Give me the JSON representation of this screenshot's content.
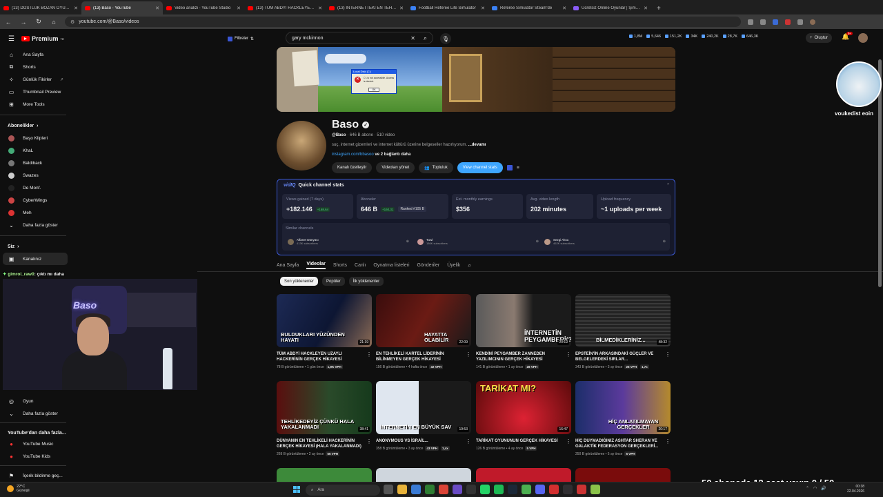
{
  "browser": {
    "tabs": [
      {
        "label": "(13) DOSTLUK BOZAN OYUN...",
        "icon": "youtube-icon"
      },
      {
        "label": "(13) Baso - YouTube",
        "icon": "youtube-icon",
        "active": true
      },
      {
        "label": "Video analizi - YouTube Studio",
        "icon": "youtube-icon"
      },
      {
        "label": "(13) TÜM ABDYİ HACKLEYEN U...",
        "icon": "youtube-icon"
      },
      {
        "label": "(13) İNTERNETTEKİ EN TEHLİKE...",
        "icon": "youtube-icon"
      },
      {
        "label": "Football Referee Life Simulator",
        "icon": "steam-icon"
      },
      {
        "label": "Referee Simulator Steam'de",
        "icon": "steam-icon"
      },
      {
        "label": "Ücretsiz Online Oyunlar | Şimdi...",
        "icon": "game-icon"
      }
    ],
    "new_tab": "+",
    "url": "youtube.com/@Baso/videos"
  },
  "yt": {
    "brand": "Premium",
    "brand_sup": "TR",
    "filters_label": "Filtreler",
    "search_value": "gary mckinnon",
    "create_label": "Oluştur",
    "notif_count": "9+",
    "header_stats": [
      "1,8M",
      "5,646",
      "151,2K",
      "34K",
      "240,2K",
      "28,7K",
      "646,3K"
    ]
  },
  "sidebar": {
    "main": [
      "Ana Sayfa",
      "Shorts",
      "Günlük Fikirler",
      "Thumbnail Preview",
      "More Tools"
    ],
    "subs_title": "Abonelikler",
    "subs": [
      "Başo Klipleri",
      "KhaL",
      "Baldiback",
      "Swazes",
      "De Monf.",
      "CyberWings",
      "Meh"
    ],
    "subs_more": "Daha fazla göster",
    "you_title": "Siz",
    "you_items": [
      "Kanalınız"
    ],
    "explore": [
      "Oyun"
    ],
    "explore_more": "Daha fazla göster",
    "more_title": "YouTube'dan daha fazla...",
    "more_items": [
      "YouTube Music",
      "YouTube Kids"
    ],
    "bottom": "İçerik bildirme geç..."
  },
  "chat": {
    "user": "gimroi_raw0",
    "msg": ": çıktı mı daha"
  },
  "cam": {
    "neon": "Baso"
  },
  "dialog": {
    "title": "Local Disk (C:)",
    "msg": "C:\\ is not accessible. Access is denied.",
    "ok": "OK"
  },
  "channel": {
    "name": "Baso",
    "handle": "@Baso",
    "subs": "646 B abone",
    "videos": "510 video",
    "desc": "suç, internet gizemleri ve internet kültürü üzerine belgeseller hazırlıyorum.",
    "desc_more": "...devamı",
    "link": "instagram.com/bbasoo",
    "link_more": "ve 2 bağlantı daha",
    "buttons": [
      "Kanalı özelleştir",
      "Videoları yönet",
      "Topluluk",
      "View channel stats"
    ]
  },
  "vidiq": {
    "title_brand": "vidIQ",
    "title": "Quick channel stats",
    "cards": [
      {
        "label": "Views gained (7 days)",
        "value": "+182.146",
        "delta": "+168,64"
      },
      {
        "label": "Aboneler",
        "value": "646 B",
        "delta": "+160,31",
        "rank": "Ranked #105 B"
      },
      {
        "label": "Est. monthly earnings",
        "value": "$356"
      },
      {
        "label": "Avg. video length",
        "value": "202 minutes"
      },
      {
        "label": "Upload frequency",
        "value": "~1 uploads per week"
      }
    ],
    "similar_label": "Similar channels",
    "similar": [
      {
        "name": "Alfanet Dünyası",
        "subs": "413K subscribers"
      },
      {
        "name": "Tuwi",
        "subs": "186K subscribers"
      },
      {
        "name": "Sezgi Aksu",
        "subs": "462K subscribers"
      }
    ]
  },
  "tabs": [
    "Ana Sayfa",
    "Videolar",
    "Shorts",
    "Canlı",
    "Oynatma listeleri",
    "Gönderiler",
    "Üyelik"
  ],
  "chips": [
    "Son yüklenenler",
    "Popüler",
    "İlk yüklenenler"
  ],
  "videos": [
    {
      "thumb": "BULDUKLARI YÜZÜNDEN HAYATI",
      "dur": "21:19",
      "title": "TÜM ABDYİ HACKLEYEN UZAYLI HACKERİNİN GERÇEK HİKAYESİ",
      "meta": "78 B görüntüleme • 1 gün önce",
      "vph": "1,9K VPH",
      "x": ""
    },
    {
      "thumb": "HAYATTA OLABİLİR",
      "dur": "22:09",
      "title": "EN TEHLİKELİ KARTEL LİDERİNİN BİLİNMEYEN GERÇEK HİKAYESİ",
      "meta": "156 B görüntüleme • 4 hafta önce",
      "vph": "32 VPH",
      "x": ""
    },
    {
      "thumb": "İNTERNETİN PEYGAMBERİ(?)",
      "dur": "20:12",
      "title": "KENDİNİ PEYGAMBER ZANNEDEN YAZILIMCININ GERÇEK HİKAYESİ",
      "meta": "141 B görüntüleme • 1 ay önce",
      "vph": "28 VPH",
      "x": ""
    },
    {
      "thumb": "BİLMEDİKLERİNİZ...",
      "dur": "48:32",
      "title": "EPSTEİN'İN ARKASINDAKİ GÜÇLER VE BELGELERDEKİ SIRLAR...",
      "meta": "343 B görüntüleme • 3 ay önce",
      "vph": "26 VPH",
      "x": "1,7x"
    },
    {
      "thumb": "TEHLİKEDEYİZ ÇÜNKÜ HALA YAKALANMADI",
      "dur": "38:41",
      "title": "DÜNYANIN EN TEHLİKELİ HACKERİNİN GERÇEK HİKAYESİ (HALA YAKALANMADI)",
      "meta": "269 B görüntüleme • 2 ay önce",
      "vph": "56 VPH",
      "x": ""
    },
    {
      "thumb": "İNTERNETİN EN BÜYÜK SAV",
      "dur": "19:53",
      "title": "ANONYMOUS VS İSRAİL...",
      "meta": "358 B görüntüleme • 3 ay önce",
      "vph": "43 VPH",
      "x": "1,4x"
    },
    {
      "thumb": "TARİKAT MI?",
      "dur": "16:47",
      "title": "TARİKAT OYUNUNUN GERÇEK HİKAYESİ",
      "meta": "126 B görüntüleme • 4 ay önce",
      "vph": "5 VPH",
      "x": ""
    },
    {
      "thumb": "HİÇ ANLATILMAYAN GERÇEKLER",
      "dur": "20:17",
      "title": "HİÇ DUYMADIĞINIZ ASHTAR SHERAN VE GALAKTİK FEDERASYON GERÇEKLERİ...",
      "meta": "250 B görüntüleme • 5 ay önce",
      "vph": "6 VPH",
      "x": ""
    }
  ],
  "overlay": {
    "cat_label": "voukedist eoin",
    "goal": "50 abonede 12 saat yayın 0 / 50"
  },
  "taskbar": {
    "temp": "22°C",
    "cond": "Güneşli",
    "search": "Ara",
    "time": "00:38",
    "date": "22.04.2026"
  },
  "colors": {
    "accent": "#3ea6ff",
    "youtube_red": "#ff0000",
    "vidiq": "#3c5ad6"
  }
}
